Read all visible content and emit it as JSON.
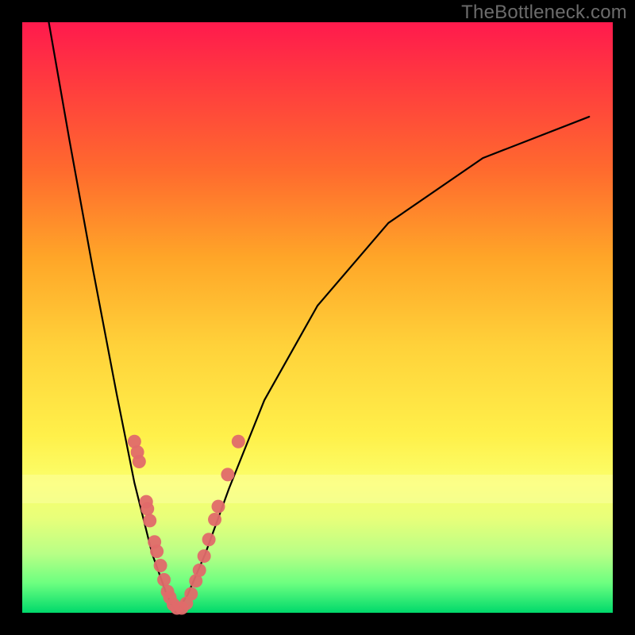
{
  "watermark": "TheBottleneck.com",
  "colors": {
    "frame": "#000000",
    "curve_stroke": "#000000",
    "dot_fill": "#e06a6a",
    "dot_stroke": "#d85a5a"
  },
  "chart_data": {
    "type": "line",
    "title": "",
    "xlabel": "",
    "ylabel": "",
    "xlim": [
      0,
      100
    ],
    "ylim": [
      0,
      100
    ],
    "note": "No axes, ticks, or numeric labels are present in the rendered image. The curve is a V-shaped bottleneck profile with its minimum at roughly x≈26, y≈0. Colors encode bottleneck severity from green (bottom/good) to red (top/bad). Coordinates below are read in image-percent units (0–100 for each axis, origin at bottom-left of the colored area) estimated from pixel positions.",
    "series": [
      {
        "name": "bottleneck-curve-left",
        "x": [
          4.5,
          8,
          12,
          16,
          19,
          22,
          24.5,
          26
        ],
        "y": [
          100,
          80,
          58,
          37,
          22,
          10,
          3,
          0
        ]
      },
      {
        "name": "bottleneck-curve-right",
        "x": [
          26,
          28,
          31,
          35,
          41,
          50,
          62,
          78,
          96
        ],
        "y": [
          0,
          3,
          10,
          21,
          36,
          52,
          66,
          77,
          84
        ]
      }
    ],
    "dots": [
      {
        "x": 19.0,
        "y": 29.0
      },
      {
        "x": 19.5,
        "y": 27.2
      },
      {
        "x": 19.8,
        "y": 25.6
      },
      {
        "x": 21.0,
        "y": 18.8
      },
      {
        "x": 21.2,
        "y": 17.6
      },
      {
        "x": 21.6,
        "y": 15.6
      },
      {
        "x": 22.4,
        "y": 12.0
      },
      {
        "x": 22.8,
        "y": 10.4
      },
      {
        "x": 23.4,
        "y": 8.0
      },
      {
        "x": 24.0,
        "y": 5.6
      },
      {
        "x": 24.6,
        "y": 3.6
      },
      {
        "x": 25.0,
        "y": 2.6
      },
      {
        "x": 25.6,
        "y": 1.4
      },
      {
        "x": 26.2,
        "y": 0.8
      },
      {
        "x": 27.0,
        "y": 0.8
      },
      {
        "x": 27.8,
        "y": 1.6
      },
      {
        "x": 28.6,
        "y": 3.2
      },
      {
        "x": 29.4,
        "y": 5.4
      },
      {
        "x": 30.0,
        "y": 7.2
      },
      {
        "x": 30.8,
        "y": 9.6
      },
      {
        "x": 31.6,
        "y": 12.4
      },
      {
        "x": 32.6,
        "y": 15.8
      },
      {
        "x": 33.2,
        "y": 18.0
      },
      {
        "x": 34.8,
        "y": 23.4
      },
      {
        "x": 36.6,
        "y": 29.0
      }
    ]
  }
}
